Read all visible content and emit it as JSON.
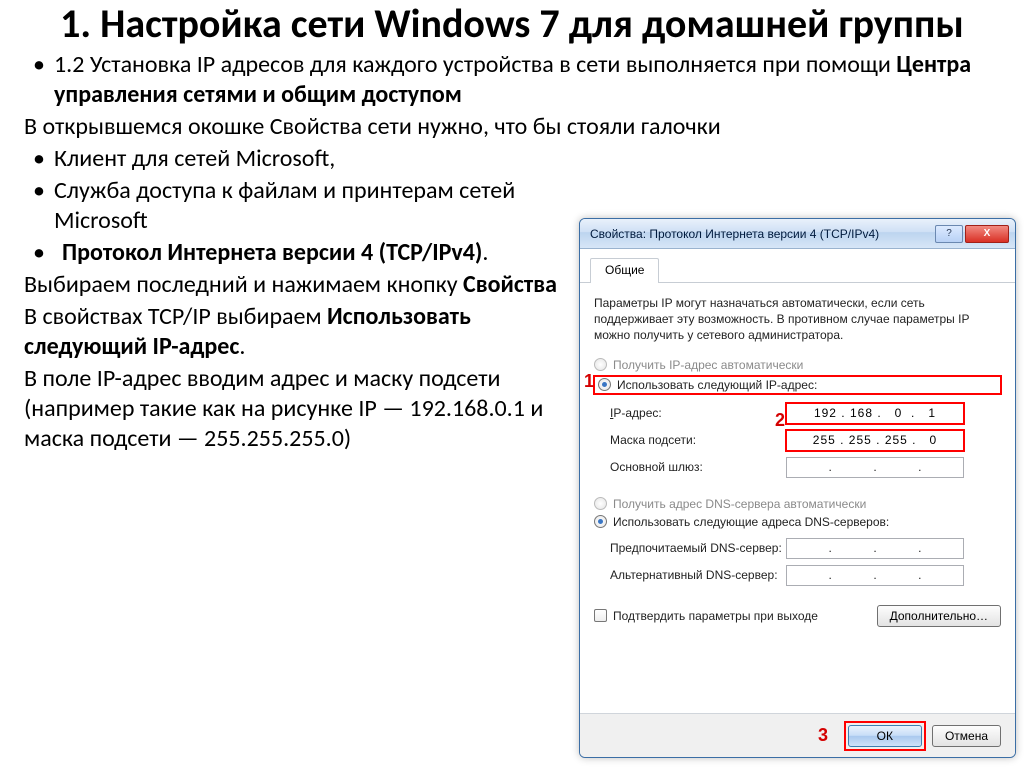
{
  "heading": "1. Настройка сети Windows 7 для домашней группы",
  "bullets_top": {
    "b1_a": "1.2 Установка IP адресов для каждого устройства в сети выполняется при помощи ",
    "b1_b": "Центра управления сетями и общим доступом"
  },
  "para1": "В открывшемся окошке Свойства сети нужно, что бы стояли галочки",
  "bullets_mid": [
    "Клиент для сетей Microsoft,",
    "Служба доступа к файлам и принтерам сетей Microsoft"
  ],
  "bullet_proto_a": "Протокол Интернета версии 4 (TCP/IPv4)",
  "bullet_proto_b": ".",
  "para2_a": "Выбираем последний и нажимаем кнопку ",
  "para2_b": "Свойства",
  "para3_a": "В свойствах TCP/IP выбираем ",
  "para3_b": "Использовать следующий IP-адрес",
  "para3_c": ".",
  "para4": "В поле IP-адрес вводим адрес и маску подсети (например такие как на рисунке IP — 192.168.0.1 и маска подсети — 255.255.255.0)",
  "dialog": {
    "title": "Свойства: Протокол Интернета версии 4 (TCP/IPv4)",
    "help": "?",
    "close": "X",
    "tab": "Общие",
    "desc": "Параметры IP могут назначаться автоматически, если сеть поддерживает эту возможность. В противном случае параметры IP можно получить у сетевого администратора.",
    "radio_auto_ip": "Получить IP-адрес автоматически",
    "radio_manual_ip": "Использовать следующий IP-адрес:",
    "lbl_ip": "IP-адрес:",
    "lbl_mask": "Маска подсети:",
    "lbl_gateway": "Основной шлюз:",
    "val_ip": "192 . 168 .   0  .   1",
    "val_mask": "255 . 255 . 255 .   0",
    "radio_auto_dns": "Получить адрес DNS-сервера автоматически",
    "radio_manual_dns": "Использовать следующие адреса DNS-серверов:",
    "lbl_dns1": "Предпочитаемый DNS-сервер:",
    "lbl_dns2": "Альтернативный DNS-сервер:",
    "chk_confirm": "Подтвердить параметры при выходе",
    "btn_more": "Дополнительно…",
    "btn_ok": "ОК",
    "btn_cancel": "Отмена"
  },
  "callouts": {
    "c1": "1",
    "c2": "2",
    "c3": "3"
  }
}
